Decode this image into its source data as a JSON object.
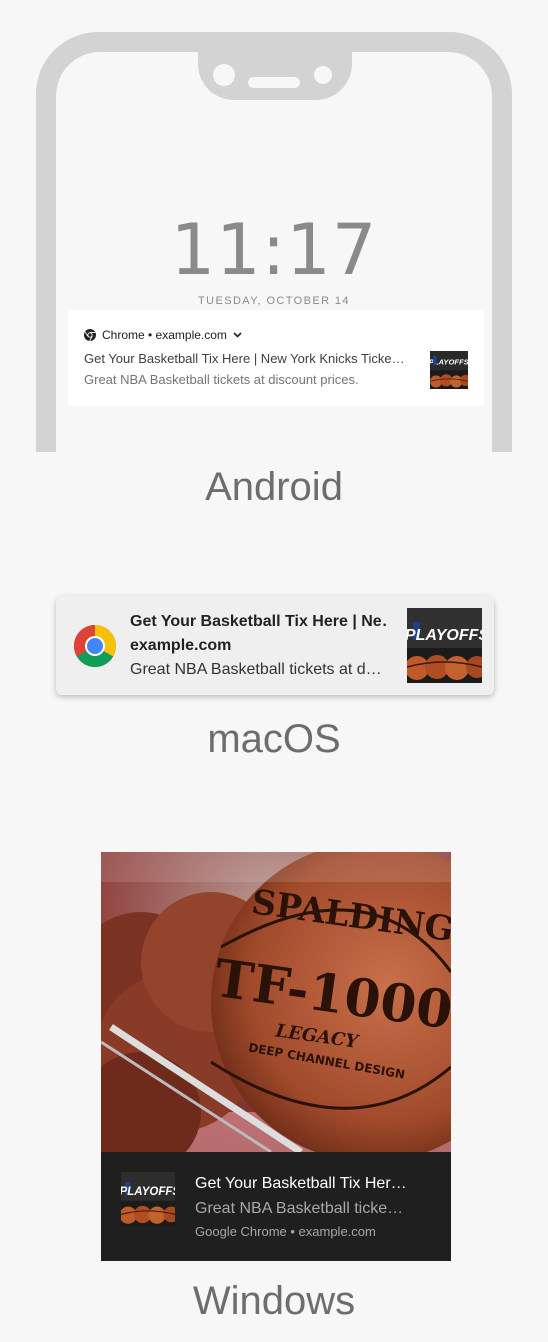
{
  "android": {
    "time": "11:17",
    "date": "TUESDAY, OCTOBER 14",
    "header": "Chrome • example.com",
    "title": "Get Your Basketball Tix Here | New York Knicks Ticke…",
    "body": "Great NBA Basketball tickets at discount prices.",
    "label": "Android"
  },
  "macos": {
    "title": "Get Your Basketball Tix Here | Ne…",
    "site": "example.com",
    "body": "Great NBA Basketball tickets at d…",
    "label": "macOS"
  },
  "windows": {
    "title": "Get Your Basketball Tix Her…",
    "body": "Great NBA Basketball ticke…",
    "attribution": "Google Chrome • example.com",
    "label": "Windows"
  },
  "thumbnail": {
    "logo_text": "PLAYOFFS"
  },
  "hero": {
    "brand_text": "SPALDING",
    "model_text": "TF-1000",
    "sub_text": "LEGACY",
    "tagline": "DEEP CHANNEL DESIGN"
  },
  "icons": {
    "browser": "chrome-icon",
    "expand": "chevron-down-icon"
  },
  "colors": {
    "chrome_red": "#db4437",
    "chrome_yellow": "#f4c20d",
    "chrome_green": "#0f9d58",
    "chrome_blue": "#4285f4",
    "windows_bar": "#1f1f1f",
    "phone_frame": "#d3d3d3"
  }
}
